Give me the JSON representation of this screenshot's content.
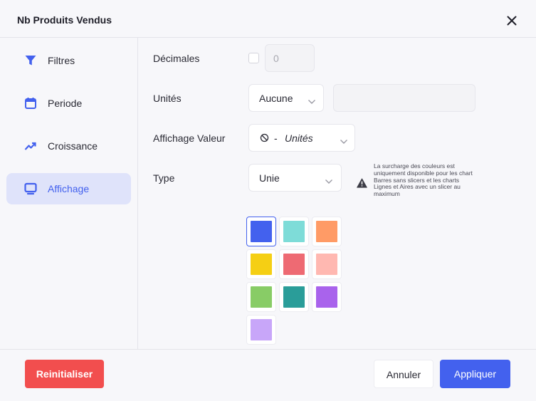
{
  "dialog": {
    "title": "Nb Produits Vendus"
  },
  "sidebar": {
    "items": [
      {
        "label": "Filtres",
        "icon": "filter-icon"
      },
      {
        "label": "Periode",
        "icon": "calendar-icon"
      },
      {
        "label": "Croissance",
        "icon": "trending-up-icon"
      },
      {
        "label": "Affichage",
        "icon": "monitor-icon",
        "active": true
      }
    ]
  },
  "form": {
    "decimales": {
      "label": "Décimales",
      "checked": false,
      "value": "0"
    },
    "unites": {
      "label": "Unités",
      "selected": "Aucune",
      "text_value": ""
    },
    "affichage_valeur": {
      "label": "Affichage Valeur",
      "prefix": "-",
      "selected": "Unités"
    },
    "type": {
      "label": "Type",
      "selected": "Unie"
    },
    "warning": "La surcharge des couleurs est uniquement disponible pour les chart Barres sans slicers et les charts Lignes et Aires avec un slicer au maximum"
  },
  "colors": [
    "#4361ee",
    "#7edcd8",
    "#ff9b66",
    "#f5cf14",
    "#ee6a73",
    "#ffb8b1",
    "#88cc66",
    "#2a9d99",
    "#a963ec",
    "#c8a6f9"
  ],
  "footer": {
    "reset": "Reinitialiser",
    "cancel": "Annuler",
    "apply": "Appliquer"
  }
}
